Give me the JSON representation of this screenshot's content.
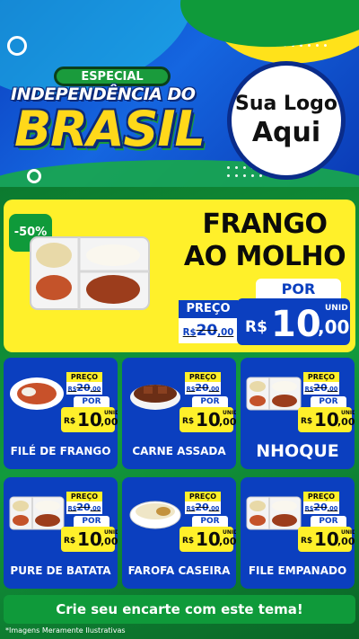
{
  "header": {
    "badge": "ESPECIAL",
    "title_line1": "INDEPENDÊNCIA DO",
    "title_line2": "BRASIL",
    "logo_line1": "Sua Logo",
    "logo_line2": "Aqui"
  },
  "featured": {
    "discount": "-50%",
    "name_line1": "FRANGO",
    "name_line2": "AO MOLHO",
    "por_label": "POR",
    "preco_label": "PREÇO",
    "old_currency": "R$",
    "old_int": "20",
    "old_cents": ",00",
    "new_currency": "R$",
    "new_int": "10",
    "new_cents": ",00",
    "unit": "UNID"
  },
  "products": [
    {
      "name": "FILÉ DE FRANGO",
      "preco_label": "PREÇO",
      "old_currency": "R$",
      "old_int": "20",
      "old_cents": ",00",
      "por_label": "POR",
      "new_currency": "R$",
      "new_int": "10",
      "new_cents": ",00",
      "unit": "UNID",
      "image": "filet-plate"
    },
    {
      "name": "CARNE ASSADA",
      "preco_label": "PREÇO",
      "old_currency": "R$",
      "old_int": "20",
      "old_cents": ",00",
      "por_label": "POR",
      "new_currency": "R$",
      "new_int": "10",
      "new_cents": ",00",
      "unit": "UNID",
      "image": "roast-beef-bowl"
    },
    {
      "name": "NHOQUE",
      "preco_label": "PREÇO",
      "old_currency": "R$",
      "old_int": "20",
      "old_cents": ",00",
      "por_label": "POR",
      "new_currency": "R$",
      "new_int": "10",
      "new_cents": ",00",
      "unit": "UNID",
      "image": "meal-tray"
    },
    {
      "name": "PURE DE BATATA",
      "preco_label": "PREÇO",
      "old_currency": "R$",
      "old_int": "20",
      "old_cents": ",00",
      "por_label": "POR",
      "new_currency": "R$",
      "new_int": "10",
      "new_cents": ",00",
      "unit": "UNID",
      "image": "meal-tray"
    },
    {
      "name": "FAROFA CASEIRA",
      "preco_label": "PREÇO",
      "old_currency": "R$",
      "old_int": "20",
      "old_cents": ",00",
      "por_label": "POR",
      "new_currency": "R$",
      "new_int": "10",
      "new_cents": ",00",
      "unit": "UNID",
      "image": "rice-bowl"
    },
    {
      "name": "FILE EMPANADO",
      "preco_label": "PREÇO",
      "old_currency": "R$",
      "old_int": "20",
      "old_cents": ",00",
      "por_label": "POR",
      "new_currency": "R$",
      "new_int": "10",
      "new_cents": ",00",
      "unit": "UNID",
      "image": "meal-tray"
    }
  ],
  "footer": {
    "cta": "Crie seu encarte com este tema!",
    "disclaimer": "*Imagens Meramente Ilustrativas"
  },
  "colors": {
    "blue": "#0b3fbf",
    "yellow": "#fff02a",
    "green": "#0f9a3a"
  }
}
